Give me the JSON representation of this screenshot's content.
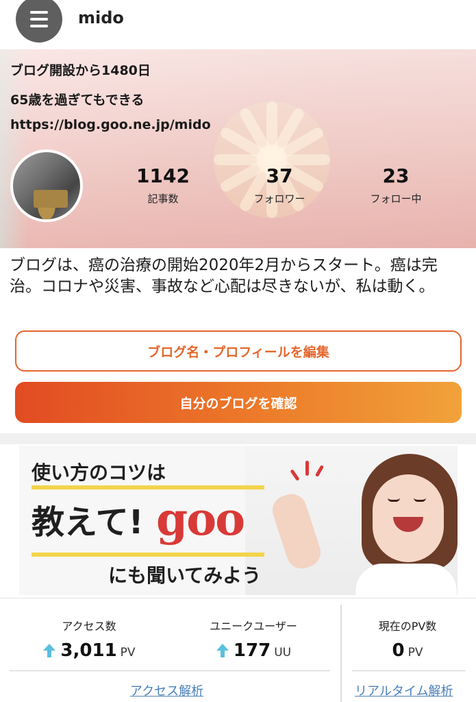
{
  "header": {
    "menu_icon": "hamburger-icon",
    "username": "mido"
  },
  "profile": {
    "since": "ブログ開設から1480日",
    "tagline": "65歳を過ぎてもできる",
    "url": "https://blog.goo.ne.jp/mido",
    "stats": [
      {
        "value": "1142",
        "label": "記事数"
      },
      {
        "value": "37",
        "label": "フォロワー"
      },
      {
        "value": "23",
        "label": "フォロー中"
      }
    ],
    "description": "ブログは、癌の治療の開始2020年2月からスタート。癌は完治。コロナや災害、事故など心配は尽きないが、私は動く。"
  },
  "buttons": {
    "edit_profile": "ブログ名・プロフィールを編集",
    "view_blog": "自分のブログを確認"
  },
  "ad": {
    "line1": "使い方のコツは",
    "line2": "教えて!",
    "brand": "goo",
    "line3": "にも聞いてみよう"
  },
  "access": {
    "access_count": {
      "label": "アクセス数",
      "value": "3,011",
      "unit": "PV",
      "trend": "up"
    },
    "unique_users": {
      "label": "ユニークユーザー",
      "value": "177",
      "unit": "UU",
      "trend": "up"
    },
    "current_pv": {
      "label": "現在のPV数",
      "value": "0",
      "unit": "PV"
    },
    "analysis_link": "アクセス解析",
    "realtime_link": "リアルタイム解析"
  },
  "colors": {
    "accent_orange": "#e5662c",
    "gradient_start": "#e24b22",
    "gradient_end": "#f1a23a",
    "link_blue": "#4a7fb8",
    "arrow_cyan": "#5bc0de"
  }
}
